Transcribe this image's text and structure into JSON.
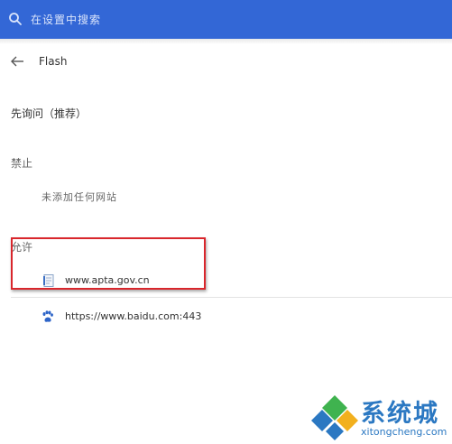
{
  "search": {
    "placeholder": "在设置中搜索"
  },
  "header": {
    "title": "Flash"
  },
  "settings": {
    "ask_first": "先询问（推荐）",
    "block": {
      "label": "禁止",
      "empty": "未添加任何网站"
    },
    "allow": {
      "label": "允许",
      "sites": [
        {
          "url": "www.apta.gov.cn",
          "icon": "page-icon"
        },
        {
          "url": "https://www.baidu.com:443",
          "icon": "baidu-paw-icon"
        }
      ]
    }
  },
  "watermark": {
    "brand": "系统城",
    "domain": "xitongcheng.com"
  },
  "colors": {
    "topbar": "#3367d6",
    "highlight": "#d9262c",
    "watermark": "#2b78c2"
  }
}
